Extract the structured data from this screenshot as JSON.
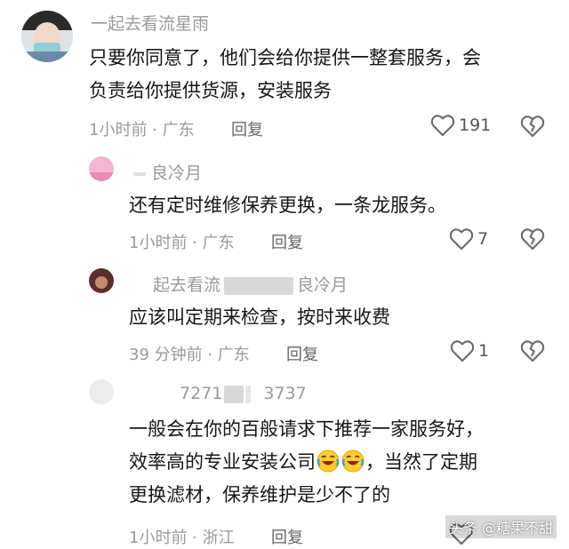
{
  "comments": [
    {
      "username": "一起去看流星雨",
      "text_line1": "只要你同意了，他们会给你提供一整套服务，会",
      "text_line2": "负责给你提供货源，安装服务",
      "meta": "1小时前 · 广东",
      "reply_label": "回复",
      "likes": "191"
    },
    {
      "username": "良冷月",
      "text_line1": "还有定时维修保养更换，一条龙服务。",
      "meta": "1小时前 · 广东",
      "reply_label": "回复",
      "likes": "7"
    },
    {
      "username_prefix": "起去看流",
      "username_suffix": "良冷月",
      "text_line1": "应该叫定期来检查，按时来收费",
      "meta": "39 分钟前 · 广东",
      "reply_label": "回复",
      "likes": "1"
    },
    {
      "username_prefix": "7271",
      "username_suffix": "3737",
      "text_line1": "一般会在你的百般请求下推荐一家服务好，",
      "text_line2_before": "效率高的专业安装公司",
      "text_line2_after": "，当然了定期",
      "text_line3": "更换滤材，保养维护是少不了的",
      "meta": "1小时前 · 浙江",
      "reply_label": "回复"
    }
  ],
  "watermark": "头条 @糖果不甜",
  "icons": {
    "like": "heart-outline-icon",
    "dislike": "broken-heart-icon",
    "emoji": "rolling-laughing-emoji"
  },
  "colors": {
    "text": "#161616",
    "meta": "#9a9a9a",
    "icon": "#6a6a6a"
  }
}
